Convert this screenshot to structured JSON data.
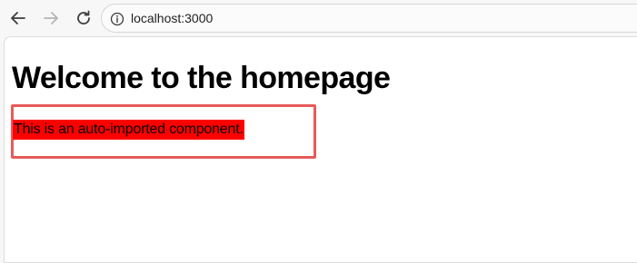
{
  "browser": {
    "url": "localhost:3000",
    "icons": {
      "back": "arrow-left-icon",
      "forward": "arrow-right-icon",
      "reload": "reload-icon",
      "site_info": "info-icon"
    }
  },
  "page": {
    "title": "Welcome to the homepage",
    "component_text": "This is an auto-imported component.",
    "colors": {
      "highlight_bg": "#ff0000",
      "annotation_border": "#e85a5a"
    }
  }
}
